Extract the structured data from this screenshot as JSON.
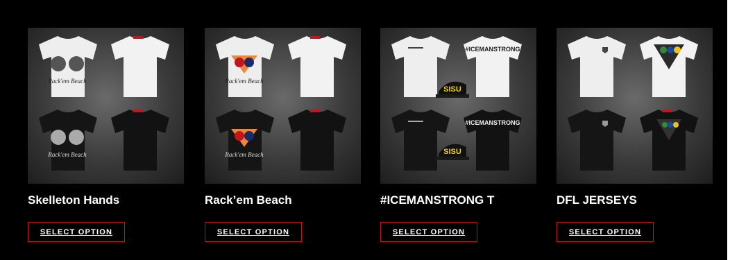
{
  "products": [
    {
      "title": "Skelleton Hands",
      "button": "SELECT OPTION",
      "graphic_text": "Rack'em Beach"
    },
    {
      "title": "Rack’em Beach",
      "button": "SELECT OPTION",
      "graphic_text": "Rack'em Beach"
    },
    {
      "title": "#ICEMANSTRONG T",
      "button": "SELECT OPTION",
      "graphic_text": "#ICEMANSTRONG",
      "cap_text": "SISU"
    },
    {
      "title": "DFL JERSEYS",
      "button": "SELECT OPTION"
    }
  ],
  "colors": {
    "background": "#000000",
    "button_border": "#c0171f",
    "text": "#ffffff",
    "cap_text": "#f5d20a"
  }
}
